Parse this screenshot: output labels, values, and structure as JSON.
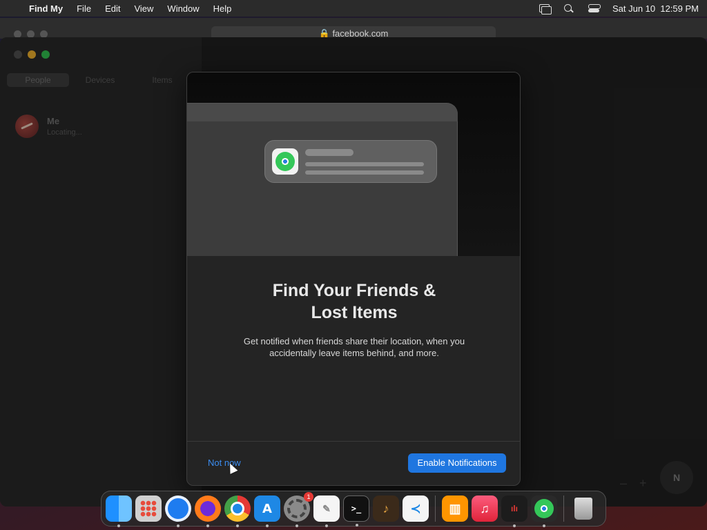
{
  "menubar": {
    "app_name": "Find My",
    "items": [
      "File",
      "Edit",
      "View",
      "Window",
      "Help"
    ],
    "datetime": "Sat Jun 10  12:59 PM"
  },
  "background_browser": {
    "url": "facebook.com"
  },
  "sidebar": {
    "tabs": [
      "People",
      "Devices",
      "Items"
    ],
    "active_tab": "People",
    "people": [
      {
        "name": "Me",
        "status": "Locating..."
      }
    ]
  },
  "map": {
    "zoom_out": "–",
    "zoom_in": "+",
    "compass": "N"
  },
  "sheet": {
    "title_line1": "Find Your Friends &",
    "title_line2": "Lost Items",
    "description_line1": "Get notified when friends share their location, when you",
    "description_line2": "accidentally leave items behind, and more.",
    "secondary_button": "Not now",
    "primary_button": "Enable Notifications"
  },
  "dock": {
    "apps": [
      {
        "name": "Finder",
        "icon": "finder-icon",
        "glyph": ""
      },
      {
        "name": "Launchpad",
        "icon": "launchpad-icon",
        "glyph": ""
      },
      {
        "name": "Safari",
        "icon": "safari-icon",
        "glyph": ""
      },
      {
        "name": "Firefox",
        "icon": "firefox-icon",
        "glyph": ""
      },
      {
        "name": "Chrome",
        "icon": "chrome-icon",
        "glyph": ""
      },
      {
        "name": "App Store",
        "icon": "app-store-icon",
        "glyph": "A"
      },
      {
        "name": "System Settings",
        "icon": "settings-icon",
        "glyph": "",
        "badge": "1"
      },
      {
        "name": "TextEdit",
        "icon": "textedit-icon",
        "glyph": "✎"
      },
      {
        "name": "Terminal",
        "icon": "terminal-icon",
        "glyph": ">_"
      },
      {
        "name": "GarageBand",
        "icon": "garageband-icon",
        "glyph": "♪"
      },
      {
        "name": "VS Code",
        "icon": "vscode-icon",
        "glyph": "≺"
      },
      {
        "name": "Books",
        "icon": "books-icon",
        "glyph": "▥"
      },
      {
        "name": "Music",
        "icon": "music-icon",
        "glyph": "♫"
      },
      {
        "name": "Voice Memos",
        "icon": "voice-memos-icon",
        "glyph": "ılı"
      },
      {
        "name": "Find My",
        "icon": "findmy-icon",
        "glyph": ""
      },
      {
        "name": "Trash",
        "icon": "trash-icon",
        "glyph": ""
      }
    ]
  },
  "colors": {
    "accent": "#1f76e0",
    "link": "#3b8df0"
  }
}
